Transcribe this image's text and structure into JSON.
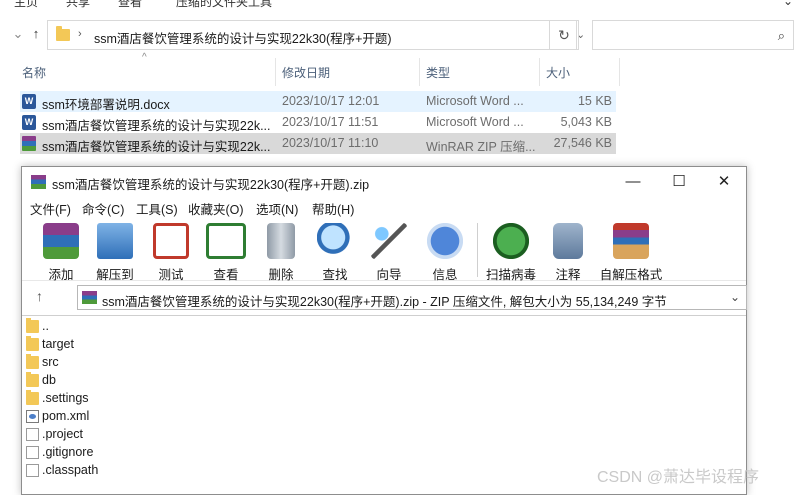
{
  "explorer": {
    "ribbon_tabs": [
      "主页",
      "共享",
      "查看",
      "压缩的文件夹工具"
    ],
    "address_path": "ssm酒店餐饮管理系统的设计与实现22k30(程序+开题)",
    "columns": {
      "name": "名称",
      "modified": "修改日期",
      "type": "类型",
      "size": "大小"
    },
    "files": [
      {
        "name": "ssm环境部署说明.docx",
        "modified": "2023/10/17 12:01",
        "type": "Microsoft Word ...",
        "size": "15 KB",
        "icon": "word-doc-icon"
      },
      {
        "name": "ssm酒店餐饮管理系统的设计与实现22k...",
        "modified": "2023/10/17 11:51",
        "type": "Microsoft Word ...",
        "size": "5,043 KB",
        "icon": "word-doc-icon"
      },
      {
        "name": "ssm酒店餐饮管理系统的设计与实现22k...",
        "modified": "2023/10/17 11:10",
        "type": "WinRAR ZIP 压缩...",
        "size": "27,546 KB",
        "icon": "winrar-archive-icon"
      }
    ]
  },
  "winrar": {
    "title": "ssm酒店餐饮管理系统的设计与实现22k30(程序+开题).zip",
    "menu": [
      "文件(F)",
      "命令(C)",
      "工具(S)",
      "收藏夹(O)",
      "选项(N)",
      "帮助(H)"
    ],
    "toolbar": [
      "添加",
      "解压到",
      "测试",
      "查看",
      "删除",
      "查找",
      "向导",
      "信息",
      "扫描病毒",
      "注释",
      "自解压格式"
    ],
    "path_info": "ssm酒店餐饮管理系统的设计与实现22k30(程序+开题).zip - ZIP 压缩文件, 解包大小为 55,134,249 字节",
    "entries": [
      {
        "name": "..",
        "icon": "folder-icon"
      },
      {
        "name": "target",
        "icon": "folder-icon"
      },
      {
        "name": "src",
        "icon": "folder-icon"
      },
      {
        "name": "db",
        "icon": "folder-icon"
      },
      {
        "name": ".settings",
        "icon": "folder-icon"
      },
      {
        "name": "pom.xml",
        "icon": "xml-file-icon"
      },
      {
        "name": ".project",
        "icon": "file-icon"
      },
      {
        "name": ".gitignore",
        "icon": "file-icon"
      },
      {
        "name": ".classpath",
        "icon": "file-icon"
      }
    ]
  },
  "watermark": "CSDN @萧达毕设程序",
  "colors": {
    "selected_row": "#e5f3ff",
    "hover_row": "#d9d9d9",
    "folder": "#f3c857",
    "word_blue": "#2b579a"
  }
}
